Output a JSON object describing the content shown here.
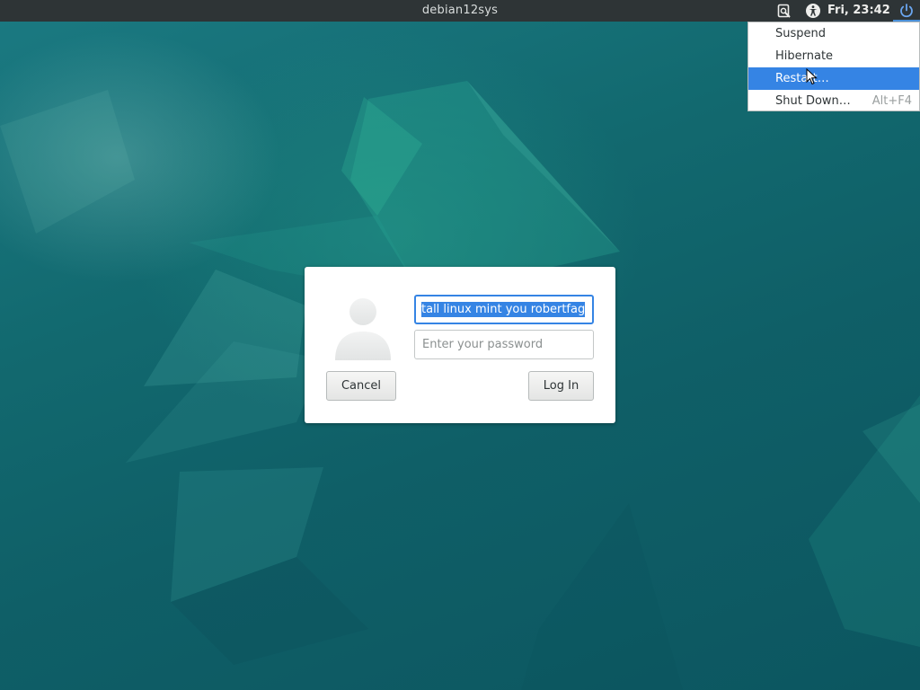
{
  "top_panel": {
    "hostname": "debian12sys",
    "clock": "Fri, 23:42",
    "icons": [
      "orca-screen-reader-icon",
      "accessibility-icon",
      "power-icon"
    ]
  },
  "power_menu": {
    "items": [
      {
        "label": "Suspend",
        "accelerator": ""
      },
      {
        "label": "Hibernate",
        "accelerator": ""
      },
      {
        "label": "Restart…",
        "accelerator": ""
      },
      {
        "label": "Shut Down…",
        "accelerator": "Alt+F4"
      }
    ],
    "highlighted_item": "Restart…"
  },
  "login": {
    "username_value": "tall linux mint you robertfag",
    "password_placeholder": "Enter your password",
    "cancel_label": "Cancel",
    "login_label": "Log In"
  },
  "colors": {
    "panel": "#2e3436",
    "accent": "#3584e4",
    "desktop": "#0f5e68"
  }
}
